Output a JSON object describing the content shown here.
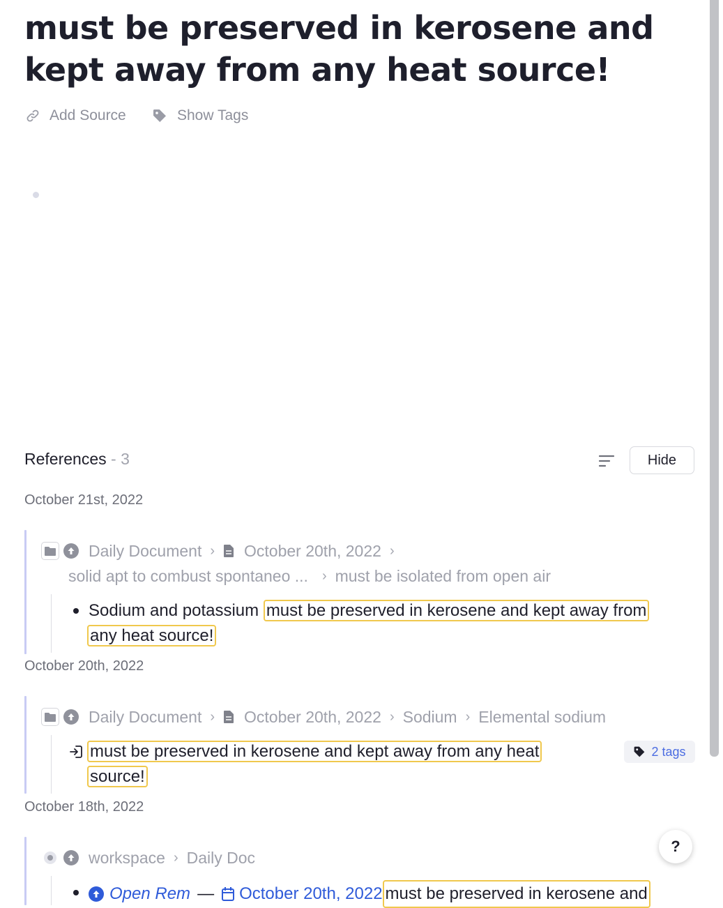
{
  "title": "must be preserved in kerosene and kept away from any heat source!",
  "meta": {
    "add_source": "Add Source",
    "show_tags": "Show Tags"
  },
  "references": {
    "label": "References",
    "count": "- 3",
    "hide_label": "Hide",
    "groups": [
      {
        "date": "October 21st, 2022",
        "breadcrumb_line1": [
          "Daily Document",
          "October 20th, 2022"
        ],
        "breadcrumb_line2": [
          "solid apt to combust spontaneo ...",
          "must be isolated from open air"
        ],
        "text_prefix": "Sodium and potassium ",
        "highlight_part1": "must be preserved in kerosene and kept away from",
        "highlight_part2": "any heat source!"
      },
      {
        "date": "October 20th, 2022",
        "breadcrumb": [
          "Daily Document",
          "October 20th, 2022",
          "Sodium",
          "Elemental sodium"
        ],
        "highlight_part1": "must be preserved in kerosene and kept away from any heat",
        "highlight_part2": "source!",
        "tags_label": "2 tags"
      },
      {
        "date": "October 18th, 2022",
        "breadcrumb": [
          "workspace",
          "Daily Doc"
        ],
        "open_rem": "Open Rem",
        "dash": "—",
        "link_date": "October 20th, 2022",
        "highlight_part1": "must be preserved in kerosene and"
      }
    ]
  },
  "help_label": "?",
  "colors": {
    "accent_blue": "#2f5bd9",
    "highlight_border": "#f0c84d",
    "reference_bar": "#c8cbf4"
  },
  "icons": [
    "link-icon",
    "tag-icon",
    "sort-icon",
    "folder-icon",
    "arrow-up-circle-icon",
    "document-icon",
    "portal-icon",
    "calendar-icon"
  ]
}
